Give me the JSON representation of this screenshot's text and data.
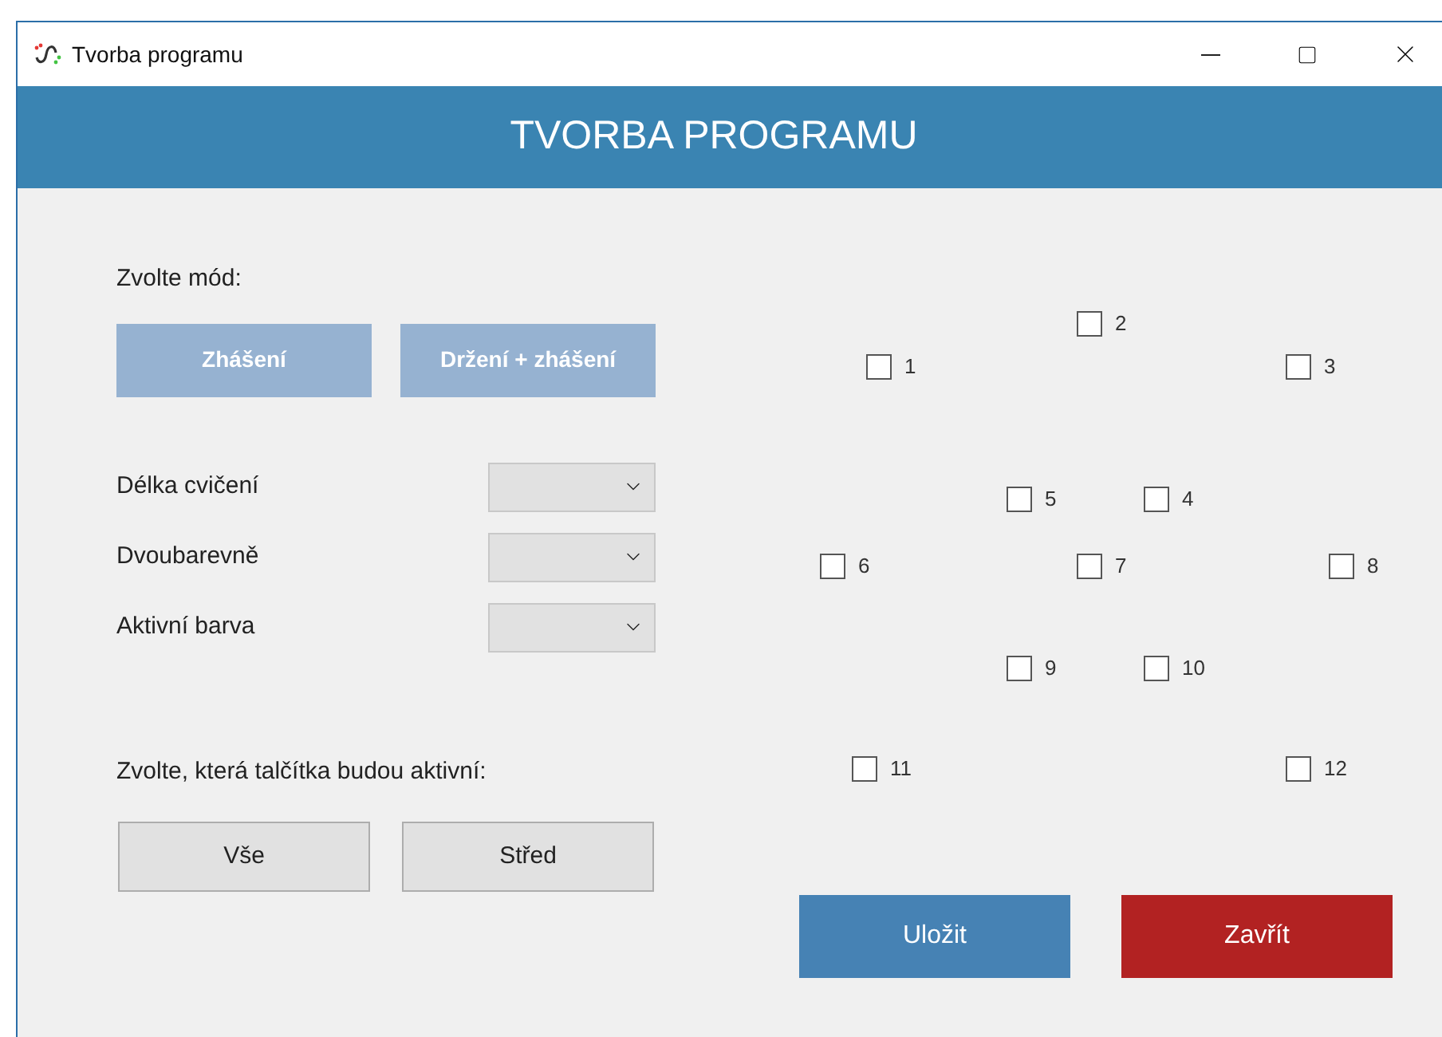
{
  "window": {
    "title": "Tvorba programu"
  },
  "header": {
    "title": "TVORBA PROGRAMU"
  },
  "mode": {
    "label": "Zvolte mód:",
    "buttons": [
      "Zhášení",
      "Držení + zhášení"
    ]
  },
  "settings": [
    {
      "label": "Délka cvičení"
    },
    {
      "label": "Dvoubarevně"
    },
    {
      "label": "Aktivní barva"
    }
  ],
  "buttons_section": {
    "label": "Zvolte, která talčítka budou aktivní:",
    "buttons": [
      "Vše",
      "Střed"
    ]
  },
  "checkboxes": [
    {
      "label": "1",
      "checked": false
    },
    {
      "label": "2",
      "checked": false
    },
    {
      "label": "3",
      "checked": false
    },
    {
      "label": "5",
      "checked": false
    },
    {
      "label": "4",
      "checked": false
    },
    {
      "label": "6",
      "checked": false
    },
    {
      "label": "7",
      "checked": false
    },
    {
      "label": "8",
      "checked": false
    },
    {
      "label": "9",
      "checked": false
    },
    {
      "label": "10",
      "checked": false
    },
    {
      "label": "11",
      "checked": false
    },
    {
      "label": "12",
      "checked": false
    }
  ],
  "actions": [
    {
      "label": "Uložit",
      "kind": "primary"
    },
    {
      "label": "Zavřít",
      "kind": "danger"
    }
  ]
}
